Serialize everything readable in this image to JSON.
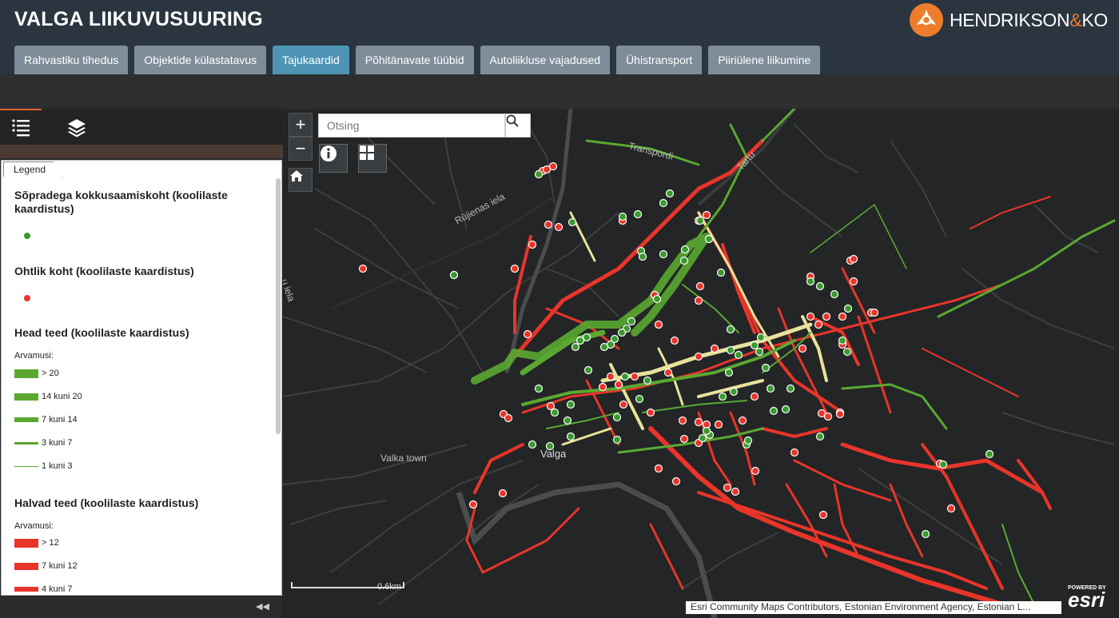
{
  "app": {
    "title": "VALGA LIIKUVUSUURING"
  },
  "brand": {
    "name": "HENDRIKSON",
    "amp": "&",
    "suffix": "KO",
    "accent": "#ee7d2b"
  },
  "tabs": [
    {
      "label": "Rahvastiku tihedus",
      "active": false
    },
    {
      "label": "Objektide külastatavus",
      "active": false
    },
    {
      "label": "Tajukaardid",
      "active": true
    },
    {
      "label": "Põhitänavate tüübid",
      "active": false
    },
    {
      "label": "Autoliikluse vajadused",
      "active": false
    },
    {
      "label": "Ühistransport",
      "active": false
    },
    {
      "label": "Piiriülene liikumine",
      "active": false
    }
  ],
  "panel": {
    "tab_icons": [
      "legend-list-icon",
      "layers-icon"
    ],
    "legend_tab_label": "Legend",
    "collapse_icon": "◀◀"
  },
  "legend": {
    "layers": [
      {
        "title": "Sõpradega kokkusaamiskoht (koolilaste kaardistus)",
        "type": "point",
        "color": "#3a9a2e"
      },
      {
        "title": "Ohtlik koht (koolilaste kaardistus)",
        "type": "point",
        "color": "#e8352a"
      },
      {
        "title": "Head teed (koolilaste kaardistus)",
        "subtitle": "Arvamusi:",
        "color": "#5aa832",
        "classes": [
          {
            "label": "> 20",
            "weight": 5
          },
          {
            "label": "14 kuni 20",
            "weight": 4
          },
          {
            "label": "7 kuni 14",
            "weight": 3
          },
          {
            "label": "3 kuni 7",
            "weight": 2
          },
          {
            "label": "1 kuni 3",
            "weight": 1
          }
        ]
      },
      {
        "title": "Halvad teed (koolilaste kaardistus)",
        "subtitle": "Arvamusi:",
        "color": "#e8352a",
        "classes": [
          {
            "label": "> 12",
            "weight": 5
          },
          {
            "label": "7 kuni 12",
            "weight": 4
          },
          {
            "label": "4 kuni 7",
            "weight": 3
          }
        ]
      }
    ]
  },
  "map": {
    "search": {
      "placeholder": "Otsing"
    },
    "controls": [
      "zoom-in-icon",
      "zoom-out-icon",
      "home-icon",
      "info-icon",
      "basemap-gallery-icon"
    ],
    "zoom_in": "+",
    "zoom_out": "−",
    "labels": {
      "transpordi": "Transpordi",
      "tartu": "Tartu",
      "rujienas": "Rūjienas iela",
      "iela": "u iela",
      "valka": "Valka town",
      "valga": "Valga"
    },
    "scale": "0.6km",
    "attribution": "Esri Community Maps Contributors, Estonian Environment Agency, Estonian L...",
    "esri_powered": "POWERED BY",
    "esri_name": "esri",
    "colors": {
      "good": "#5aa832",
      "bad": "#e8352a",
      "neutral": "#e8e29a",
      "road": "#3d3f41"
    }
  }
}
